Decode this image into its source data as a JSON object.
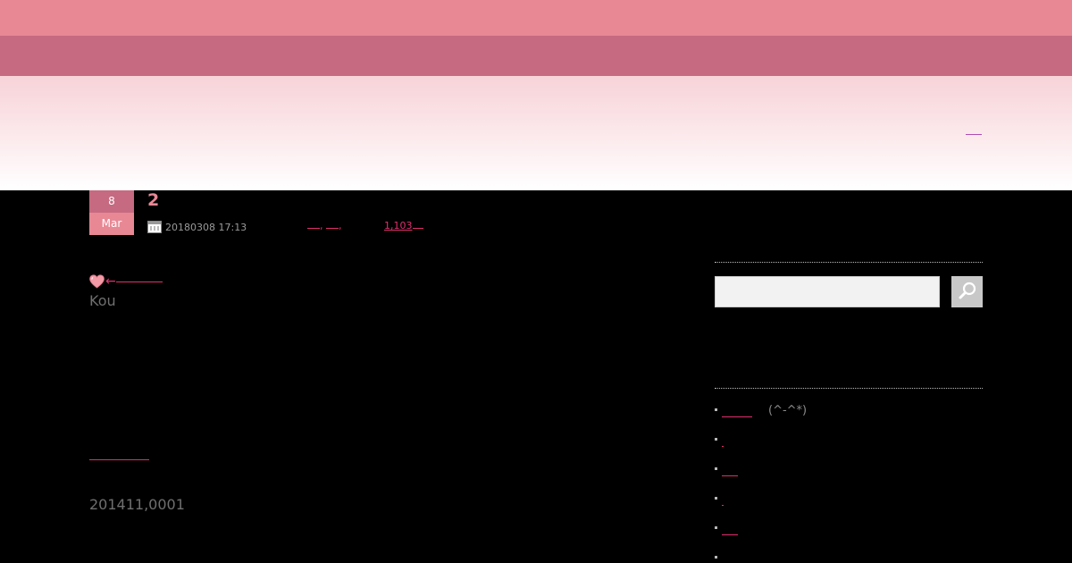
{
  "header": {
    "link_label": ""
  },
  "post": {
    "date_day": "8",
    "date_month": "Mar",
    "title": "2",
    "date_text": "20180308 17:13",
    "category_separators": [
      ", ",
      ", "
    ],
    "views": "1,103",
    "heart_link": "←",
    "author": "Kou",
    "code": "201411,0001"
  },
  "sidebar": {
    "search_placeholder": "",
    "items": [
      {
        "link": "",
        "note": "(^-^*)"
      },
      {
        "link": "",
        "note": ""
      },
      {
        "link": "",
        "note": ""
      },
      {
        "link": "",
        "note": ""
      },
      {
        "link": "",
        "note": ""
      },
      {
        "link": "",
        "note": ""
      }
    ]
  },
  "colors": {
    "band_top": "#e88895",
    "band_mid": "#c56a80",
    "accent_link": "#e0306e",
    "background": "#000000"
  },
  "icons": [
    "calendar-icon",
    "heart-icon",
    "search-icon"
  ]
}
